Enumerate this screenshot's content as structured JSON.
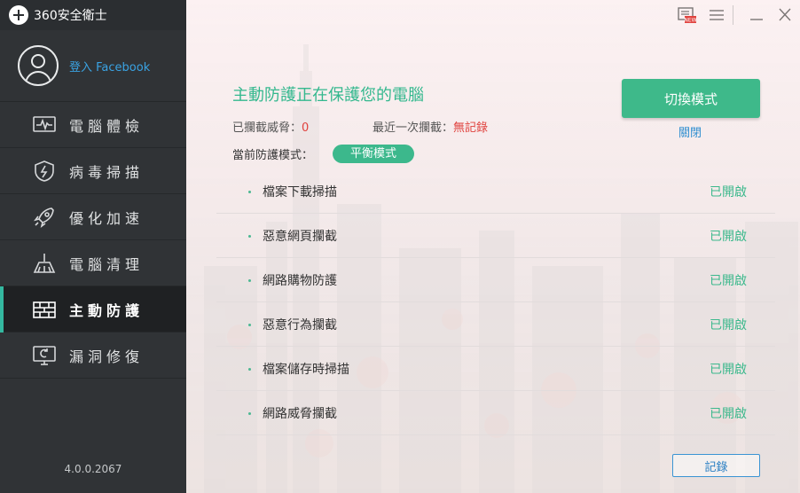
{
  "app": {
    "title": "360安全衛士",
    "version": "4.0.0.2067"
  },
  "account": {
    "login_label": "登入 Facebook"
  },
  "sidebar": {
    "items": [
      {
        "label": "電腦體檢",
        "icon": "pulse-monitor-icon",
        "active": false
      },
      {
        "label": "病毒掃描",
        "icon": "shield-bolt-icon",
        "active": false
      },
      {
        "label": "優化加速",
        "icon": "rocket-icon",
        "active": false
      },
      {
        "label": "電腦清理",
        "icon": "broom-icon",
        "active": false
      },
      {
        "label": "主動防護",
        "icon": "firewall-icon",
        "active": true
      },
      {
        "label": "漏洞修復",
        "icon": "monitor-repair-icon",
        "active": false
      }
    ]
  },
  "window_controls": [
    "new-badge-icon",
    "menu-icon",
    "minimize-icon",
    "close-icon"
  ],
  "main": {
    "status_title": "主動防護正在保護您的電腦",
    "blocked_label": "已攔截威脅：",
    "blocked_value": "0",
    "last_block_label": "最近一次攔截：",
    "last_block_value": "無記錄",
    "mode_label": "當前防護模式：",
    "mode_value": "平衡模式",
    "switch_button": "切換模式",
    "close_link": "關閉",
    "record_button": "記錄",
    "protections": [
      {
        "name": "檔案下載掃描",
        "state": "已開啟"
      },
      {
        "name": "惡意網頁攔截",
        "state": "已開啟"
      },
      {
        "name": "網路購物防護",
        "state": "已開啟"
      },
      {
        "name": "惡意行為攔截",
        "state": "已開啟"
      },
      {
        "name": "檔案儲存時掃描",
        "state": "已開啟"
      },
      {
        "name": "網路威脅攔截",
        "state": "已開啟"
      }
    ]
  },
  "colors": {
    "accent": "#3eb98a",
    "sidebar": "#303336",
    "link": "#2f8ed0",
    "alert": "#e0423e"
  }
}
